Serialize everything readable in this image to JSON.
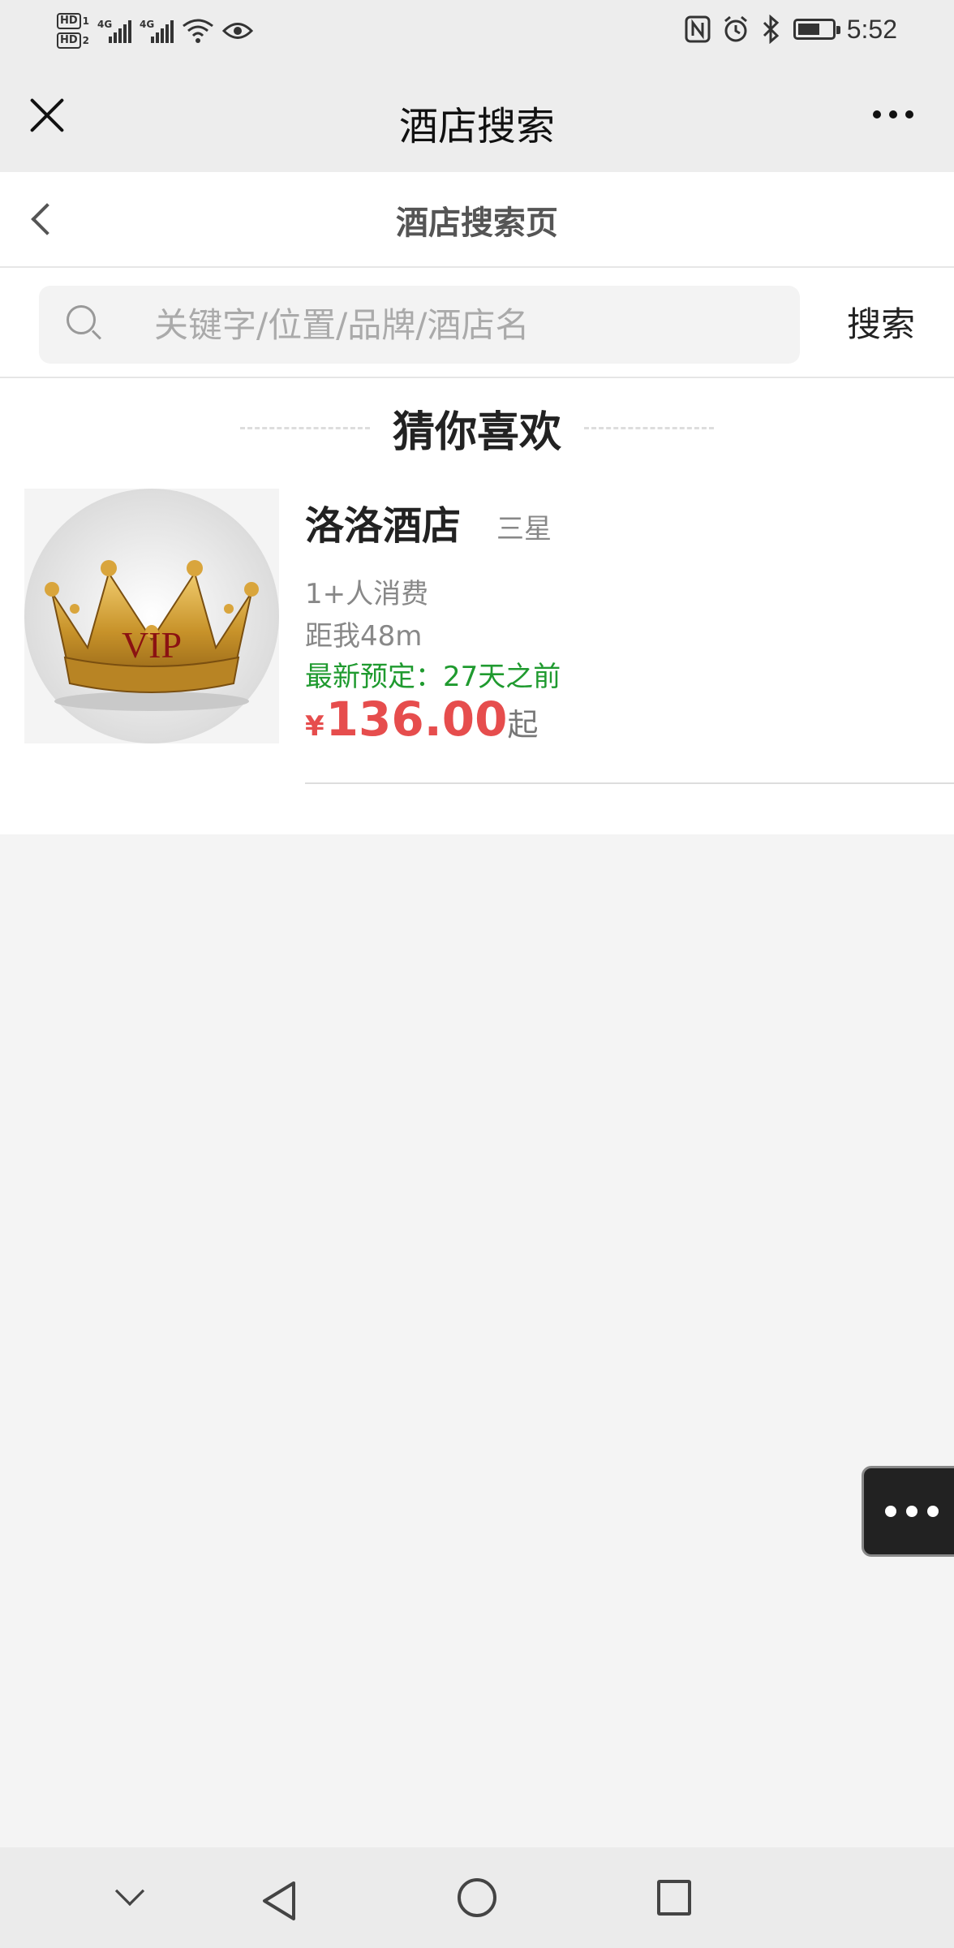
{
  "status_bar": {
    "sim1": "HD",
    "sim1_num": "1",
    "sim2": "HD",
    "sim2_num": "2",
    "network1": "4G",
    "network2": "4G",
    "time": "5:52",
    "icons": [
      "signal-icon",
      "wifi-icon",
      "eye-icon",
      "nfc-icon",
      "alarm-icon",
      "bluetooth-icon",
      "battery-icon"
    ]
  },
  "titlebar": {
    "title": "酒店搜索"
  },
  "subheader": {
    "title": "酒店搜索页"
  },
  "search": {
    "placeholder": "关键字/位置/品牌/酒店名",
    "value": "",
    "button_label": "搜索"
  },
  "section": {
    "title": "猜你喜欢"
  },
  "hotels": [
    {
      "name": "洛洛酒店",
      "star": "三星",
      "consumption": "1+人消费",
      "distance": "距我48m",
      "latest_booking": "最新预定：27天之前",
      "currency": "¥",
      "price": "136.00",
      "price_suffix": "起",
      "image_text": "VIP"
    }
  ],
  "colors": {
    "price": "#e64d4d",
    "booking": "#1f9a2f",
    "crown_gold": "#c8932a"
  }
}
